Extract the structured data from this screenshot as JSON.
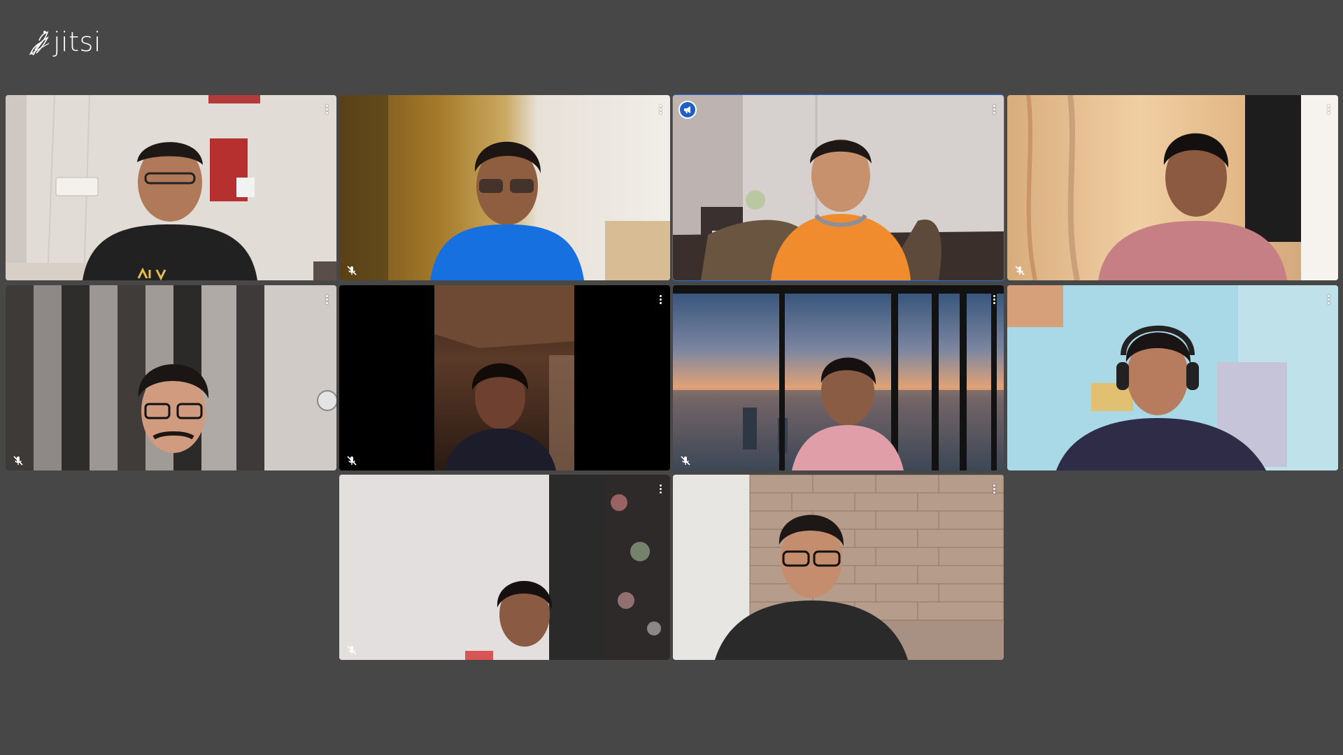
{
  "app": {
    "logo_text": "jitsi",
    "accent_color": "#246fe5",
    "background_color": "#474747"
  },
  "participants": [
    {
      "id": "p1",
      "muted": false,
      "dominant_speaker": false
    },
    {
      "id": "p2",
      "muted": true,
      "dominant_speaker": false
    },
    {
      "id": "p3",
      "muted": false,
      "dominant_speaker": true
    },
    {
      "id": "p4",
      "muted": true,
      "dominant_speaker": false
    },
    {
      "id": "p5",
      "muted": true,
      "dominant_speaker": false
    },
    {
      "id": "p6",
      "muted": true,
      "dominant_speaker": false
    },
    {
      "id": "p7",
      "muted": true,
      "dominant_speaker": false
    },
    {
      "id": "p8",
      "muted": false,
      "dominant_speaker": false
    },
    {
      "id": "p9",
      "muted": true,
      "dominant_speaker": false
    },
    {
      "id": "p10",
      "muted": false,
      "dominant_speaker": false
    }
  ],
  "icons": {
    "logo": "jitsi-logo-icon",
    "menu": "more-vertical-icon",
    "muted": "mic-off-icon",
    "dominant": "megaphone-icon"
  }
}
